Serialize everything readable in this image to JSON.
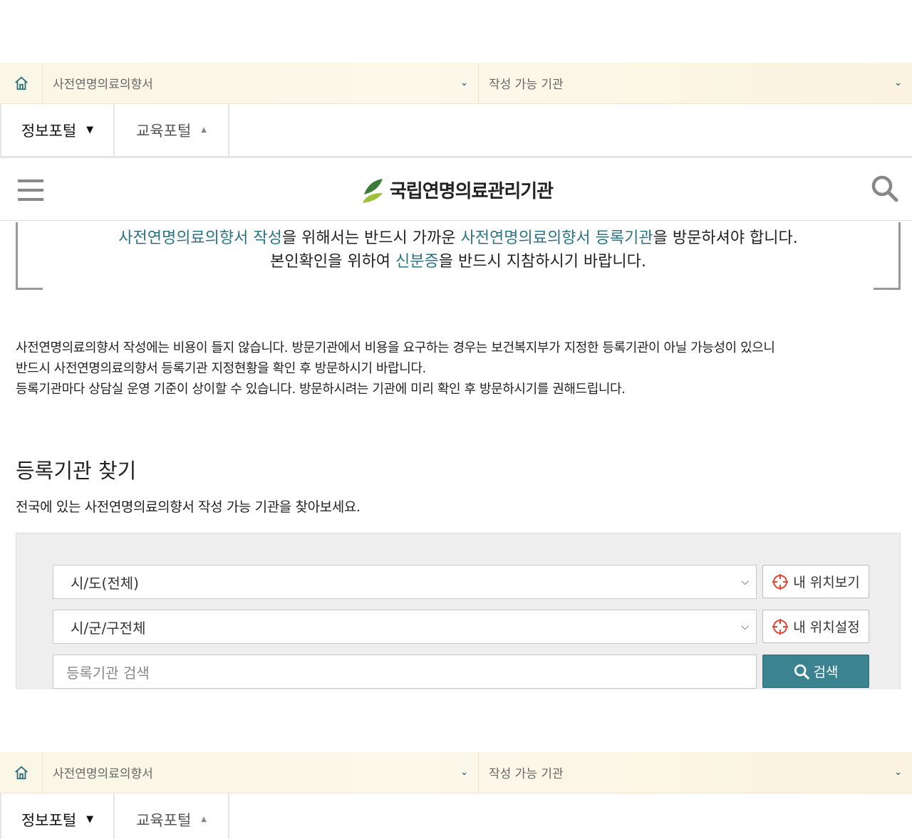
{
  "breadcrumb": {
    "menu_label": "사전연명의료의향서",
    "submenu_label": "작성 가능 기관"
  },
  "portal_tabs": [
    {
      "label": "정보포털",
      "arrow": "▼"
    },
    {
      "label": "교육포털",
      "arrow": "▲"
    }
  ],
  "header": {
    "logo_text": "국립연명의료관리기관"
  },
  "notice": {
    "line1": [
      {
        "text": "사전연명의료의향서 작성",
        "hl": true
      },
      {
        "text": "을 위해서는 반드시 가까운 ",
        "hl": false
      },
      {
        "text": "사전연명의료의향서 등록기관",
        "hl": true
      },
      {
        "text": "을 방문하셔야 합니다.",
        "hl": false
      }
    ],
    "line2": [
      {
        "text": "본인확인을 위하여 ",
        "hl": false
      },
      {
        "text": "신분증",
        "hl": true
      },
      {
        "text": "을 반드시 지참하시기 바랍니다.",
        "hl": false
      }
    ]
  },
  "info": {
    "line1": "사전연명의료의향서 작성에는 비용이 들지 않습니다. 방문기관에서 비용을 요구하는 경우는 보건복지부가 지정한 등록기관이 아닐 가능성이 있으니",
    "line2": "반드시 사전연명의료의향서 등록기관 지정현황을 확인 후 방문하시기 바랍니다.",
    "line3": "등록기관마다 상담실 운영 기준이 상이할 수 있습니다. 방문하시려는 기관에 미리 확인 후 방문하시기를 권해드립니다."
  },
  "finder": {
    "title": "등록기관 찾기",
    "description": "전국에 있는 사전연명의료의향서 작성 가능 기관을 찾아보세요.",
    "sido_value": "시/도(전체)",
    "sigungu_value": "시/군/구전체",
    "search_placeholder": "등록기관 검색",
    "my_location_view": "내 위치보기",
    "my_location_set": "내 위치설정",
    "search_button": "검색"
  },
  "colors": {
    "accent": "#2c7383",
    "search_button": "#3c8391",
    "breadcrumb_bg": "#fbf7e6"
  }
}
